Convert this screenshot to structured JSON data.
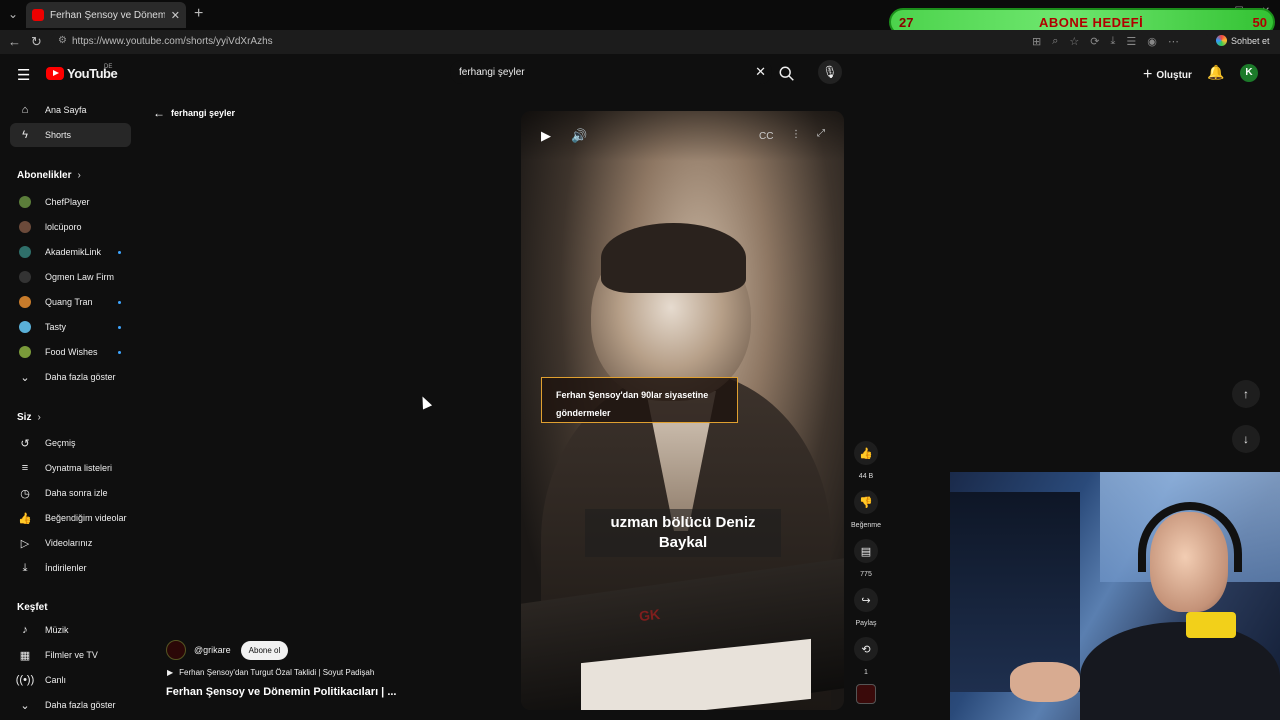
{
  "browser": {
    "tab_title": "Ferhan Şensoy ve Dönemin Politik",
    "url": "https://www.youtube.com/shorts/yyiVdXrAzhs",
    "chat_label": "Sohbet et"
  },
  "goal_overlay": {
    "start": "27",
    "label": "ABONE HEDEFİ",
    "end": "50"
  },
  "header": {
    "logo_text": "YouTube",
    "country": "DE",
    "search_value": "ferhangi şeyler",
    "create_label": "Oluştur",
    "avatar_letter": "K"
  },
  "sidebar": {
    "main": [
      {
        "label": "Ana Sayfa"
      },
      {
        "label": "Shorts"
      }
    ],
    "subscriptions_heading": "Abonelikler",
    "subscriptions": [
      {
        "label": "ChefPlayer",
        "color": "#5b7d3a"
      },
      {
        "label": "lolcüporo",
        "color": "#6b4a3a"
      },
      {
        "label": "AkademikLink",
        "color": "#2f6f6a"
      },
      {
        "label": "Ogmen Law Firm",
        "color": "#333333"
      },
      {
        "label": "Quang Tran",
        "color": "#c77b2b"
      },
      {
        "label": "Tasty",
        "color": "#5ab0d8"
      },
      {
        "label": "Food Wishes",
        "color": "#7a9a3a"
      }
    ],
    "show_more": "Daha fazla göster",
    "you_heading": "Siz",
    "you": [
      {
        "label": "Geçmiş"
      },
      {
        "label": "Oynatma listeleri"
      },
      {
        "label": "Daha sonra izle"
      },
      {
        "label": "Beğendiğim videolar"
      },
      {
        "label": "Videolarınız"
      },
      {
        "label": "İndirilenler"
      }
    ],
    "explore_heading": "Keşfet",
    "explore": [
      {
        "label": "Müzik"
      },
      {
        "label": "Filmler ve TV"
      },
      {
        "label": "Canlı"
      }
    ],
    "explore_more": "Daha fazla göster"
  },
  "back_label": "ferhangi şeyler",
  "video": {
    "caption_box": "Ferhan Şensoy'dan 90lar siyasetine göndermeler",
    "subtitle": "uzman bölücü Deniz Baykal"
  },
  "actions": {
    "likes": "44 B",
    "dislike_label": "Beğenme",
    "comments": "775",
    "share_label": "Paylaş",
    "remix_count": "1"
  },
  "channel": {
    "handle": "@grikare",
    "subscribe_label": "Abone ol",
    "playlist": "Ferhan Şensoy'dan Turgut Özal Taklidi | Soyut Padişah",
    "title": "Ferhan Şensoy ve Dönemin Politikacıları | ..."
  }
}
